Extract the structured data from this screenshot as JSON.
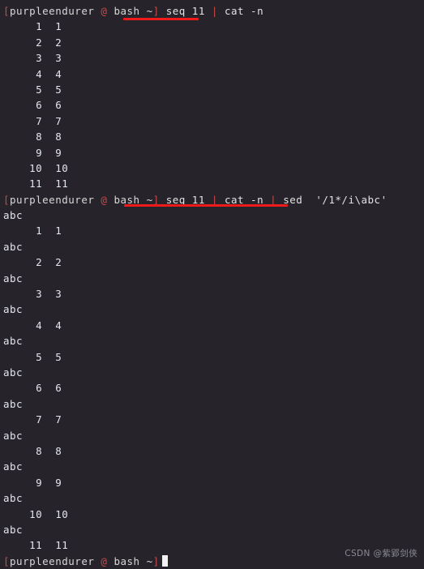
{
  "terminal": {
    "background_color": "#26242a",
    "foreground_color": "#e4e6ef",
    "accent_color": "#c94a4a",
    "underline_color": "#ef1b1b",
    "prompt": {
      "open_bracket": "[",
      "user": "purpleendurer",
      "at": "@",
      "host": "bash",
      "path": "~",
      "close_bracket": "]"
    },
    "commands": {
      "first": {
        "full": "seq 11 | cat -n",
        "part1": "seq 11 ",
        "pipe1": "|",
        "part2": " cat -n"
      },
      "second": {
        "full": "seq 11 | cat -n | sed  '/1*/i\\abc'",
        "part1": "seq 11 ",
        "pipe1": "|",
        "part2": " cat -n ",
        "pipe2": "|",
        "part3": " sed  '/1*/i\\abc'"
      }
    },
    "output_first": [
      "     1\t1",
      "     2\t2",
      "     3\t3",
      "     4\t4",
      "     5\t5",
      "     6\t6",
      "     7\t7",
      "     8\t8",
      "     9\t9",
      "    10\t10",
      "    11\t11"
    ],
    "output_second": [
      "abc",
      "     1\t1",
      "abc",
      "     2\t2",
      "abc",
      "     3\t3",
      "abc",
      "     4\t4",
      "abc",
      "     5\t5",
      "abc",
      "     6\t6",
      "abc",
      "     7\t7",
      "abc",
      "     8\t8",
      "abc",
      "     9\t9",
      "abc",
      "    10\t10",
      "abc",
      "    11\t11"
    ],
    "cursor_visible": true
  },
  "watermark": {
    "text": "CSDN @紫郢剑侠"
  }
}
